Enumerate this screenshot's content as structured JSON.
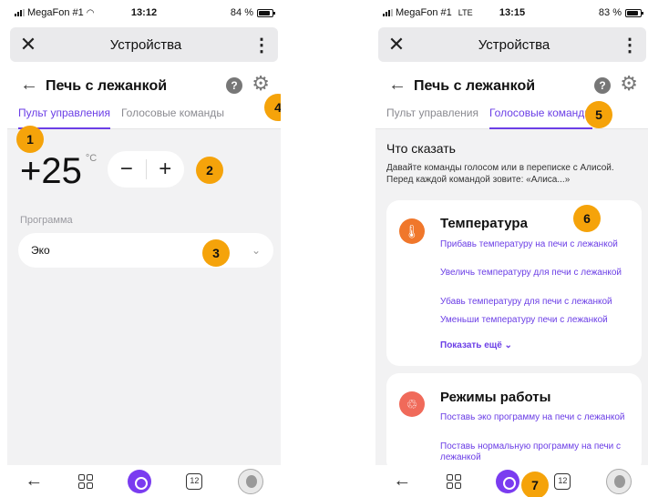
{
  "left": {
    "status": {
      "carrier": "MegaFon #1",
      "network": "",
      "time": "13:12",
      "battery": "84 %"
    },
    "appbar": {
      "close": "✕",
      "title": "Устройства",
      "menu": "⋮"
    },
    "header": {
      "back": "←",
      "title": "Печь с лежанкой",
      "help": "?",
      "gear": "⚙"
    },
    "tabs": [
      {
        "label": "Пульт управления",
        "active": true
      },
      {
        "label": "Голосовые команды",
        "active": false
      }
    ],
    "temperature": {
      "value": "+25",
      "unit": "°C"
    },
    "stepper": {
      "minus": "−",
      "plus": "+"
    },
    "program": {
      "label": "Программа",
      "value": "Эко",
      "chevron": "⌄"
    },
    "badges": {
      "b1": "1",
      "b2": "2",
      "b3": "3",
      "b4": "4"
    }
  },
  "right": {
    "status": {
      "carrier": "MegaFon #1",
      "network": "LTE",
      "time": "13:15",
      "battery": "83 %"
    },
    "appbar": {
      "close": "✕",
      "title": "Устройства",
      "menu": "⋮"
    },
    "header": {
      "back": "←",
      "title": "Печь с лежанкой",
      "help": "?",
      "gear": "⚙"
    },
    "tabs": [
      {
        "label": "Пульт управления",
        "active": false
      },
      {
        "label": "Голосовые команды",
        "active": true
      }
    ],
    "say": {
      "title": "Что сказать",
      "desc": "Давайте команды голосом или в переписке с Алисой. Перед каждой командой зовите: «Алиса...»"
    },
    "cards": [
      {
        "title": "Температура",
        "icon": "🌡",
        "icon_color": "#f0772b",
        "commands": [
          "Прибавь температуру на печи с лежанкой",
          "Увеличь температуру для печи с лежанкой",
          "Убавь температуру для печи с лежанкой",
          "Уменьши температуру печи с лежанкой"
        ],
        "more": "Показать ещё ⌄"
      },
      {
        "title": "Режимы работы",
        "icon": "♲",
        "icon_color": "#f06a5a",
        "commands": [
          "Поставь эко программу на печи с лежанкой",
          "Поставь нормальную программу на печи с лежанкой"
        ]
      }
    ],
    "badges": {
      "b5": "5",
      "b6": "6",
      "b7": "7"
    }
  },
  "bottombar": {
    "back": "←",
    "tabs_count": "12"
  },
  "colors": {
    "accent": "#6b3ee6",
    "badge": "#f5a30a",
    "alice": "#7a3cf0"
  }
}
